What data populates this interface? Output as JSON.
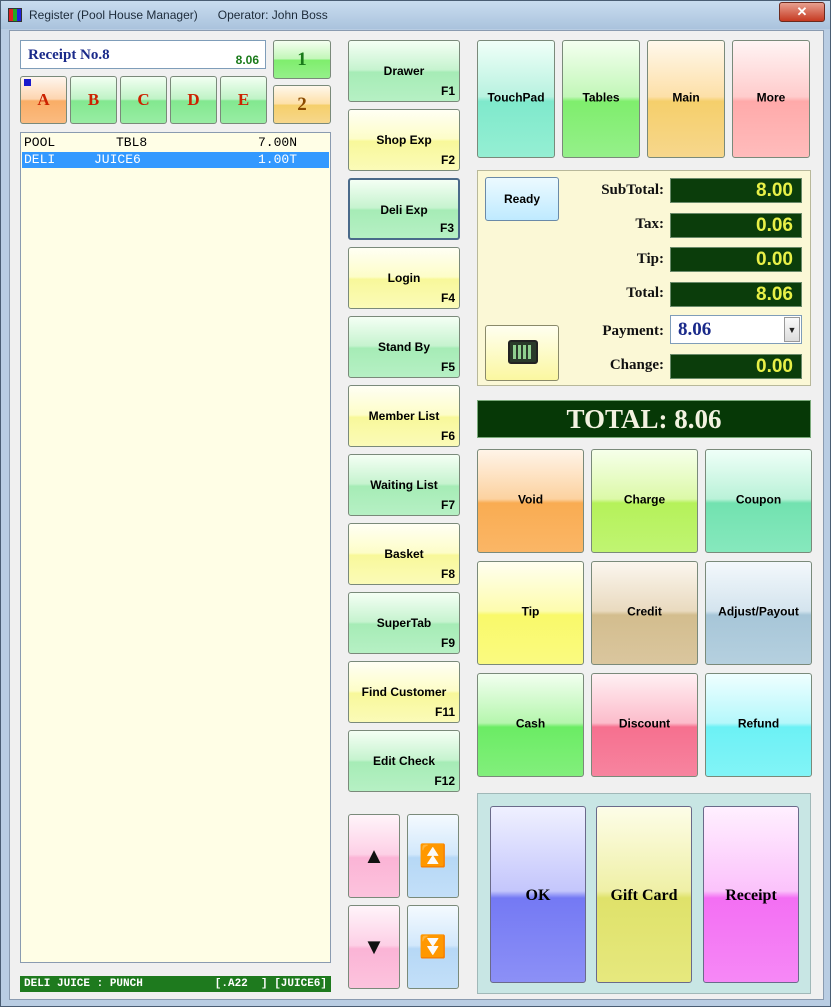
{
  "window": {
    "title": "Register (Pool House Manager)      Operator: John Boss",
    "close_label": "✕"
  },
  "receipt": {
    "label": "Receipt No.8",
    "amount": "8.06"
  },
  "tabs": [
    "A",
    "B",
    "C",
    "D",
    "E"
  ],
  "num_buttons": [
    "1",
    "2"
  ],
  "order_items": [
    {
      "category": "POOL",
      "item": "TBL8",
      "price": "7.00N",
      "selected": false
    },
    {
      "category": "DELI",
      "item": "JUICE6",
      "price": "1.00T",
      "selected": true
    }
  ],
  "status_bar": {
    "left": "DELI JUICE : PUNCH",
    "right": "[.A22  ] [JUICE6]"
  },
  "function_buttons": [
    {
      "label": "Drawer",
      "key": "F1"
    },
    {
      "label": "Shop Exp",
      "key": "F2"
    },
    {
      "label": "Deli Exp",
      "key": "F3"
    },
    {
      "label": "Login",
      "key": "F4"
    },
    {
      "label": "Stand By",
      "key": "F5"
    },
    {
      "label": "Member List",
      "key": "F6"
    },
    {
      "label": "Waiting List",
      "key": "F7"
    },
    {
      "label": "Basket",
      "key": "F8"
    },
    {
      "label": "SuperTab",
      "key": "F9"
    },
    {
      "label": "Find Customer",
      "key": "F11"
    },
    {
      "label": "Edit Check",
      "key": "F12"
    }
  ],
  "top_nav": [
    "TouchPad",
    "Tables",
    "Main",
    "More"
  ],
  "totals": {
    "ready_label": "Ready",
    "subtotal_label": "SubTotal:",
    "subtotal": "8.00",
    "tax_label": "Tax:",
    "tax": "0.06",
    "tip_label": "Tip:",
    "tip": "0.00",
    "total_label": "Total:",
    "total": "8.06",
    "payment_label": "Payment:",
    "payment": "8.06",
    "change_label": "Change:",
    "change": "0.00",
    "dropdown_glyph": "▼"
  },
  "grand_total": "TOTAL: 8.06",
  "action_buttons": [
    "Void",
    "Charge",
    "Coupon",
    "Tip",
    "Credit",
    "Adjust/Payout",
    "Cash",
    "Discount",
    "Refund"
  ],
  "big_buttons": [
    "OK",
    "Gift Card",
    "Receipt"
  ],
  "arrows": {
    "up": "▲",
    "page_up": "⏫",
    "down": "▼",
    "page_down": "⏬"
  },
  "colors": {
    "selected_row": "#3399ff",
    "status_bar": "#1e7a1e",
    "total_display": "#0b3d0b",
    "total_text": "#e8f048"
  }
}
